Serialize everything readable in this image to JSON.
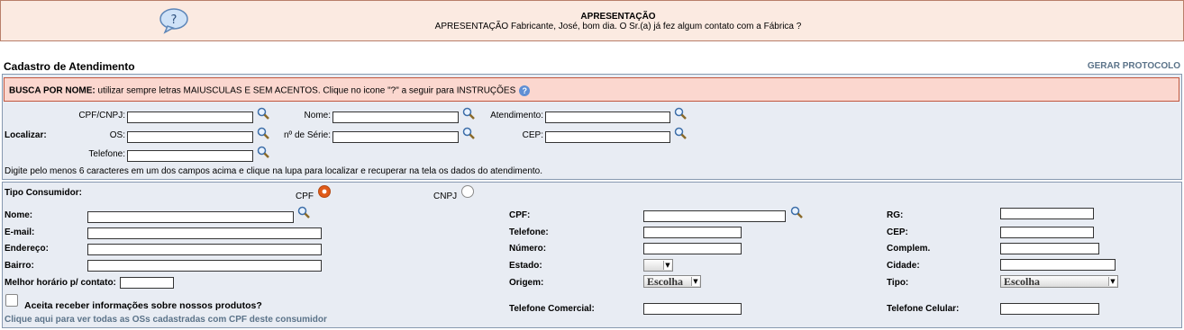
{
  "banner": {
    "title": "APRESENTAÇÃO",
    "text": "APRESENTAÇÃO Fabricante, José, bom dia. O Sr.(a) já fez algum contato com a Fábrica ?"
  },
  "section": {
    "title": "Cadastro de Atendimento",
    "gerar_protocolo": "GERAR PROTOCOLO"
  },
  "search": {
    "alert_bold": "BUSCA POR NOME:",
    "alert_text": " utilizar sempre letras MAIUSCULAS E SEM ACENTOS. Clique no icone \"?\" a seguir para INSTRUÇÕES",
    "localizar_label": "Localizar:",
    "fields": {
      "cpf_cnpj": "CPF/CNPJ:",
      "nome": "Nome:",
      "atendimento": "Atendimento:",
      "os": "OS:",
      "serie": "nº de Série:",
      "cep": "CEP:",
      "telefone": "Telefone:"
    },
    "hint": "Digite pelo menos 6 caracteres em um dos campos acima e clique na lupa para localizar e recuperar na tela os dados do atendimento."
  },
  "consumer": {
    "tipo_label": "Tipo Consumidor:",
    "radio_cpf": "CPF",
    "radio_cnpj": "CNPJ",
    "selected_type": "CPF",
    "labels": {
      "nome": "Nome:",
      "email": "E-mail:",
      "endereco": "Endereço:",
      "bairro": "Bairro:",
      "horario": "Melhor horário p/ contato:",
      "cpf": "CPF:",
      "telefone": "Telefone:",
      "numero": "Número:",
      "estado": "Estado:",
      "origem": "Origem:",
      "tel_comercial": "Telefone Comercial:",
      "rg": "RG:",
      "cep": "CEP:",
      "complem": "Complem.",
      "cidade": "Cidade:",
      "tipo": "Tipo:",
      "tel_celular": "Telefone Celular:"
    },
    "origem_value": "Escolha",
    "tipo_value": "Escolha",
    "estado_value": "",
    "aceita": "Aceita receber informações sobre nossos produtos?",
    "link_os": "Clique aqui para ver todas as OSs cadastradas com CPF deste consumidor"
  },
  "colors": {
    "banner_bg": "#fbeae1",
    "panel_bg": "#e8ecf3",
    "alert_bg": "#fbd7cf",
    "link": "#5b7389",
    "radio_selected": "#e05a18"
  }
}
